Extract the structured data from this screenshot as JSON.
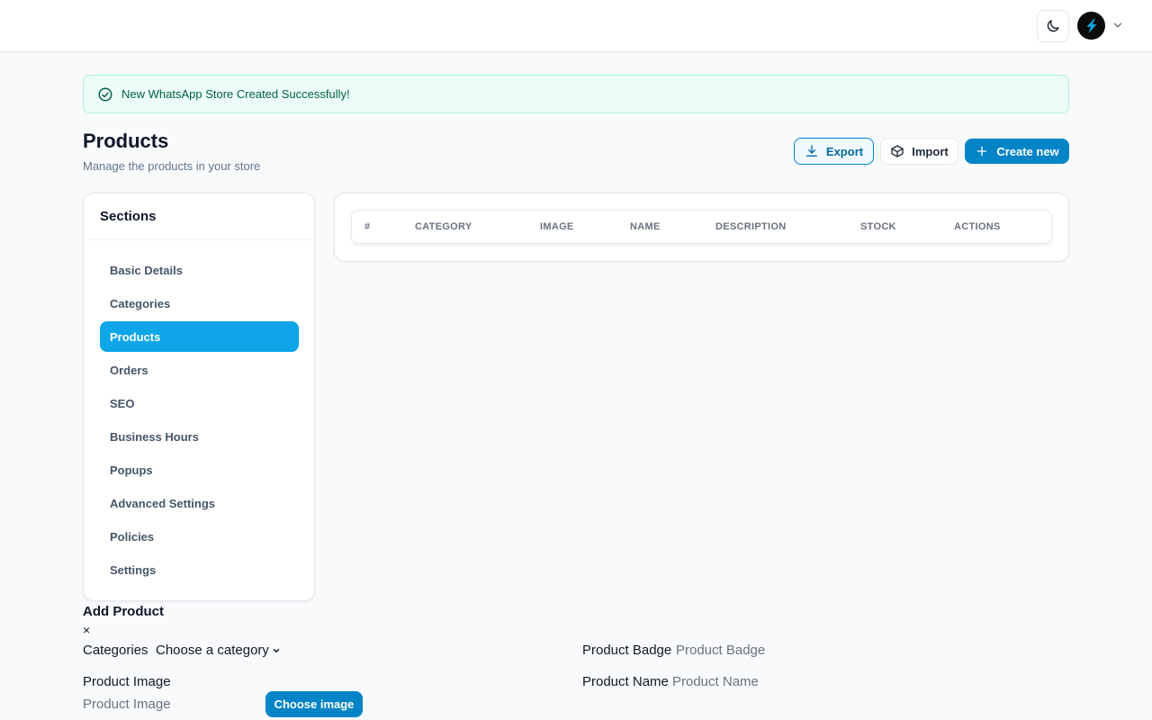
{
  "header": {
    "theme_icon": "moon-icon",
    "avatar_icon": "bolt-logo-icon",
    "menu_icon": "chevron-down-icon"
  },
  "alert": {
    "message": "New WhatsApp Store Created Successfully!",
    "icon": "check-circle-icon",
    "color": "#065f46"
  },
  "page": {
    "title": "Products",
    "subtitle": "Manage the products in your store"
  },
  "actions": {
    "export_label": "Export",
    "import_label": "Import",
    "create_label": "Create new"
  },
  "sidebar": {
    "title": "Sections",
    "items": [
      {
        "label": "Basic Details"
      },
      {
        "label": "Categories"
      },
      {
        "label": "Products",
        "active": true
      },
      {
        "label": "Orders"
      },
      {
        "label": "SEO"
      },
      {
        "label": "Business Hours"
      },
      {
        "label": "Popups"
      },
      {
        "label": "Advanced Settings"
      },
      {
        "label": "Policies"
      },
      {
        "label": "Settings"
      }
    ]
  },
  "table": {
    "columns": [
      "#",
      "CATEGORY",
      "IMAGE",
      "NAME",
      "DESCRIPTION",
      "STOCK",
      "ACTIONS"
    ]
  },
  "form": {
    "title": "Add Product",
    "close": "×",
    "categories_label": "Categories",
    "categories_value": "Choose a category",
    "badge_label": "Product Badge",
    "badge_placeholder": "Product Badge",
    "image_label": "Product Image",
    "image_placeholder": "Product Image",
    "choose_image_label": "Choose image",
    "name_label": "Product Name",
    "name_placeholder": "Product Name"
  },
  "colors": {
    "accent": "#0284c7",
    "active_nav": "#0ea5e9",
    "success_bg": "#ecfdf5"
  }
}
